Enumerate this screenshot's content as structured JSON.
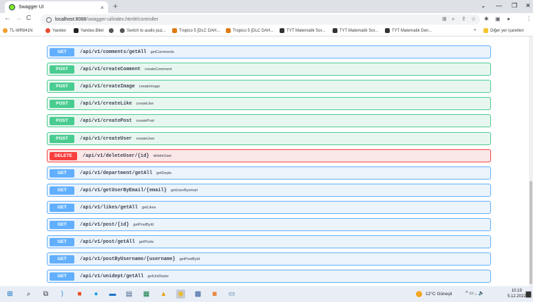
{
  "browser": {
    "tab_title": "Swagger UI",
    "tab_close": "×",
    "new_tab": "+",
    "url_host": "localhost:8088",
    "url_path": "/swagger-ui/index.html#/controller",
    "window_controls": {
      "chevron": "⌄",
      "minimize": "—",
      "restore": "❐",
      "close": "✕"
    },
    "nav": {
      "back": "←",
      "forward": "→",
      "reload": "C"
    },
    "toolbar_icons": [
      "⊞",
      "⌕",
      "⇪",
      "☆",
      "✱",
      "▣",
      "●",
      "⋮"
    ]
  },
  "bookmarks": [
    {
      "label": "TL-WR841N",
      "color": "#f0a030"
    },
    {
      "label": "Yandex",
      "color": "#e84b2c"
    },
    {
      "label": "Yandex.Bilet",
      "color": "#222222"
    },
    {
      "label": "",
      "color": "#555555"
    },
    {
      "label": "Switch to audio puz...",
      "color": "#555555"
    },
    {
      "label": "Tropico 5 [DLC DAH...",
      "color": "#e07a10"
    },
    {
      "label": "Tropico 5 [DLC DAH...",
      "color": "#e07a10"
    },
    {
      "label": "TYT Matematik Sor...",
      "color": "#333333"
    },
    {
      "label": "TYT Matematik Sor...",
      "color": "#333333"
    },
    {
      "label": "TYT Matematik Den...",
      "color": "#333333"
    },
    {
      "label": "»",
      "color": ""
    },
    {
      "label": "Diğer yer işaretleri",
      "color": "#f4c430"
    }
  ],
  "operations": [
    {
      "method": "GET",
      "path": "/api/v1/comments/getAll",
      "summary": "getComments"
    },
    {
      "method": "POST",
      "path": "/api/v1/createComment",
      "summary": "createComment"
    },
    {
      "method": "POST",
      "path": "/api/v1/createImage",
      "summary": "createImage"
    },
    {
      "method": "POST",
      "path": "/api/v1/createLike",
      "summary": "createLike"
    },
    {
      "method": "POST",
      "path": "/api/v1/createPost",
      "summary": "createPost"
    },
    {
      "method": "POST",
      "path": "/api/v1/createUser",
      "summary": "createUser"
    },
    {
      "method": "DELETE",
      "path": "/api/v1/deleteUser/{id}",
      "summary": "deleteUser"
    },
    {
      "method": "GET",
      "path": "/api/v1/department/getAll",
      "summary": "getDepts"
    },
    {
      "method": "GET",
      "path": "/api/v1/getUserByEmail/{email}",
      "summary": "getUserByemail"
    },
    {
      "method": "GET",
      "path": "/api/v1/likes/getAll",
      "summary": "getLikes"
    },
    {
      "method": "GET",
      "path": "/api/v1/post/{id}",
      "summary": "getPostById"
    },
    {
      "method": "GET",
      "path": "/api/v1/post/getAll",
      "summary": "getPosts"
    },
    {
      "method": "GET",
      "path": "/api/v1/postByUsername/{username}",
      "summary": "getPostById"
    },
    {
      "method": "GET",
      "path": "/api/v1/unidept/getAll",
      "summary": "getUniDepts"
    }
  ],
  "taskbar": {
    "weather": "12°C Güneşli",
    "tray": "^ ▭ ◟ 🔈",
    "time": "10:19",
    "date": "5.12.2022"
  },
  "colors": {
    "get": "#61affe",
    "post": "#49cc90",
    "delete": "#f93e3e"
  }
}
